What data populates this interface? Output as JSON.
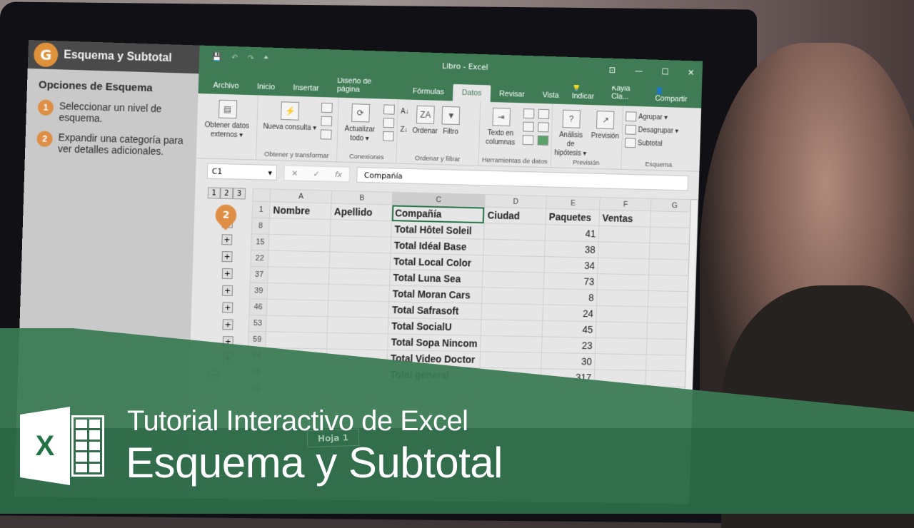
{
  "tutorial": {
    "title": "Esquema y Subtotal",
    "section_title": "Opciones de Esquema",
    "steps": [
      {
        "num": "1",
        "text": "Seleccionar un nivel de esquema."
      },
      {
        "num": "2",
        "text": "Expandir una categoría para ver detalles adicionales."
      }
    ],
    "callout_num": "2"
  },
  "excel": {
    "window_title": "Libro  -  Excel",
    "qat": {
      "save": "💾",
      "undo": "↶",
      "redo": "↷",
      "customize": "⩡"
    },
    "window_controls": {
      "ribbon_display": "⊡",
      "minimize": "—",
      "maximize": "☐",
      "close": "✕"
    },
    "tabs": [
      "Archivo",
      "Inicio",
      "Insertar",
      "Diseño de página",
      "Fórmulas",
      "Datos",
      "Revisar",
      "Vista"
    ],
    "active_tab": "Datos",
    "tell_me": "Indicar",
    "user": "Kayla Cla...",
    "share": "Compartir",
    "ribbon": {
      "groups": [
        {
          "label": "",
          "buttons": [
            "Obtener datos externos ▾"
          ]
        },
        {
          "label": "Obtener y transformar",
          "buttons": [
            "Nueva consulta ▾"
          ]
        },
        {
          "label": "Conexiones",
          "buttons": [
            "Actualizar todo ▾"
          ]
        },
        {
          "label": "Ordenar y filtrar",
          "buttons": [
            "Ordenar",
            "Filtro"
          ]
        },
        {
          "label": "Herramientas de datos",
          "buttons": [
            "Texto en columnas"
          ]
        },
        {
          "label": "Previsión",
          "buttons": [
            "Análisis de hipótesis ▾",
            "Previsión"
          ]
        },
        {
          "label": "Esquema",
          "buttons": [
            "Agrupar ▾",
            "Desagrupar ▾",
            "Subtotal"
          ]
        }
      ]
    },
    "name_box": "C1",
    "formula": "Compañía",
    "outline_levels": [
      "1",
      "2",
      "3"
    ],
    "columns": [
      "A",
      "B",
      "C",
      "D",
      "E",
      "F",
      "G"
    ],
    "headers": {
      "row": "1",
      "A": "Nombre",
      "B": "Apellido",
      "C": "Compañía",
      "D": "Ciudad",
      "E": "Paquetes",
      "F": "Ventas"
    },
    "rows": [
      {
        "row": "8",
        "company": "Total Hôtel Soleil",
        "packages": "41"
      },
      {
        "row": "15",
        "company": "Total Idéal Base",
        "packages": "38"
      },
      {
        "row": "22",
        "company": "Total Local Color",
        "packages": "34"
      },
      {
        "row": "37",
        "company": "Total Luna Sea",
        "packages": "73"
      },
      {
        "row": "39",
        "company": "Total Moran Cars",
        "packages": "8"
      },
      {
        "row": "46",
        "company": "Total Safrasoft",
        "packages": "24"
      },
      {
        "row": "53",
        "company": "Total SocialU",
        "packages": "45"
      },
      {
        "row": "59",
        "company": "Total Sopa Nincom",
        "packages": "23"
      },
      {
        "row": "64",
        "company": "Total Video Doctor",
        "packages": "30"
      },
      {
        "row": "65",
        "company": "Total general",
        "packages": "317"
      },
      {
        "row": "66",
        "company": "",
        "packages": ""
      }
    ],
    "sheet_tab": "Hoja 1"
  },
  "banner": {
    "line1": "Tutorial Interactivo de Excel",
    "line2": "Esquema y Subtotal",
    "logo_letter": "X"
  },
  "colors": {
    "excel_green": "#3f7c55",
    "accent_orange": "#de8f45"
  }
}
